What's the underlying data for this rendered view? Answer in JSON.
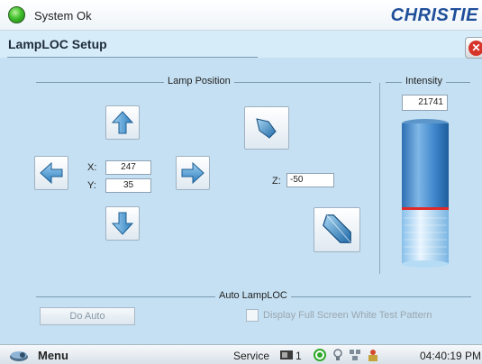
{
  "status": {
    "text": "System Ok",
    "color": "#3fbf2a"
  },
  "brand": {
    "name": "CHRISTIE"
  },
  "page": {
    "title": "LampLOC Setup",
    "close_icon": "close-icon"
  },
  "lamp_position": {
    "label": "Lamp Position",
    "x_label": "X:",
    "y_label": "Y:",
    "z_label": "Z:",
    "x_value": "247",
    "y_value": "35",
    "z_value": "-50",
    "buttons": {
      "up": "arrow-up-icon",
      "down": "arrow-down-icon",
      "left": "arrow-left-icon",
      "right": "arrow-right-icon",
      "z_in": "z-in-icon",
      "z_out": "z-out-icon"
    }
  },
  "intensity": {
    "label": "Intensity",
    "value": "21741",
    "marker_color": "#e02a2a"
  },
  "auto_lamploc": {
    "label": "Auto LampLOC",
    "do_auto_label": "Do Auto",
    "checkbox_label": "Display Full Screen White Test Pattern",
    "checkbox_checked": false
  },
  "taskbar": {
    "menu_label": "Menu",
    "service_label": "Service",
    "projector_count": "1",
    "time": "04:40:19 PM"
  }
}
